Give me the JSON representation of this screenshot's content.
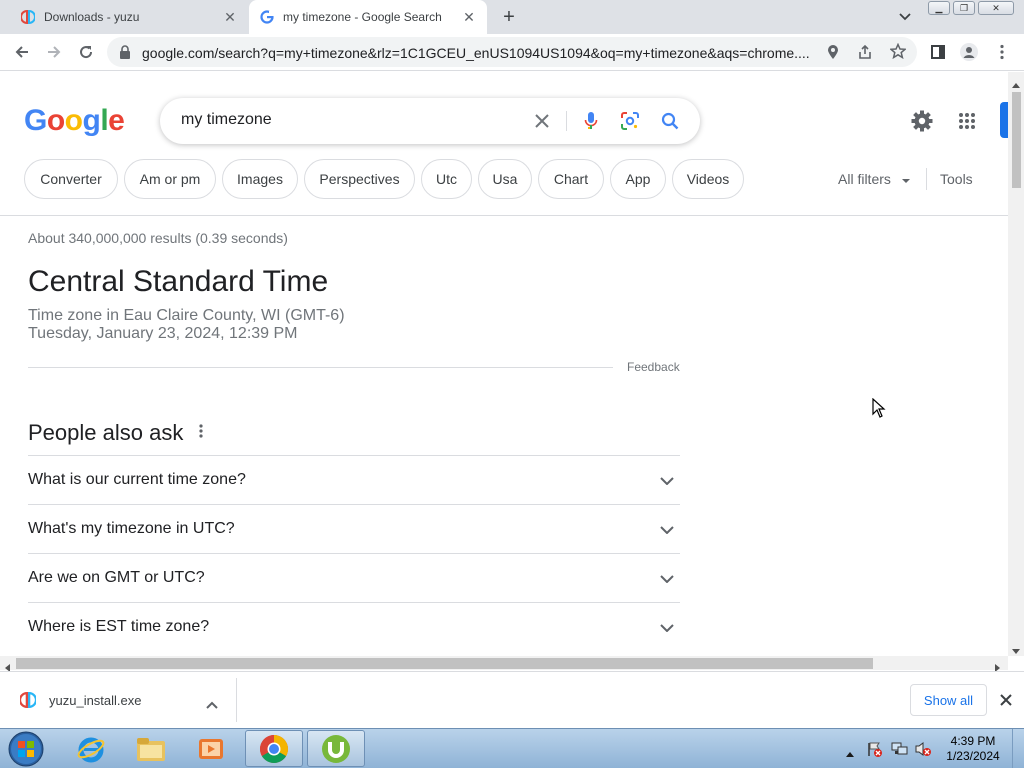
{
  "tabs": [
    {
      "title": "Downloads - yuzu",
      "active": false
    },
    {
      "title": "my timezone - Google Search",
      "active": true
    }
  ],
  "toolbar": {
    "url": "google.com/search?q=my+timezone&rlz=1C1GCEU_enUS1094US1094&oq=my+timezone&aqs=chrome...."
  },
  "google": {
    "logo_letters": [
      "G",
      "o",
      "o",
      "g",
      "l",
      "e"
    ],
    "logo_colors": [
      "#4285f4",
      "#ea4335",
      "#fbbc05",
      "#4285f4",
      "#34a853",
      "#ea4335"
    ],
    "query": "my timezone",
    "chips": [
      "Converter",
      "Am or pm",
      "Images",
      "Perspectives",
      "Utc",
      "Usa",
      "Chart",
      "App",
      "Videos"
    ],
    "all_filters": "All filters",
    "tools": "Tools"
  },
  "results": {
    "stats": "About 340,000,000 results (0.39 seconds)",
    "timezone_name": "Central Standard Time",
    "timezone_location": "Time zone in Eau Claire County, WI (GMT-6)",
    "timezone_datetime": "Tuesday, January 23, 2024, 12:39 PM",
    "feedback": "Feedback"
  },
  "people_also_ask": {
    "heading": "People also ask",
    "questions": [
      "What is our current time zone?",
      "What's my timezone in UTC?",
      "Are we on GMT or UTC?",
      "Where is EST time zone?"
    ]
  },
  "downloads": {
    "file_name": "yuzu_install.exe",
    "show_all": "Show all"
  },
  "taskbar": {
    "time": "4:39 PM",
    "date": "1/23/2024"
  },
  "colors": {
    "accent_blue": "#1a73e8",
    "chrome_tabstrip": "#dee1e6",
    "taskbar": "#a3c2e0"
  }
}
